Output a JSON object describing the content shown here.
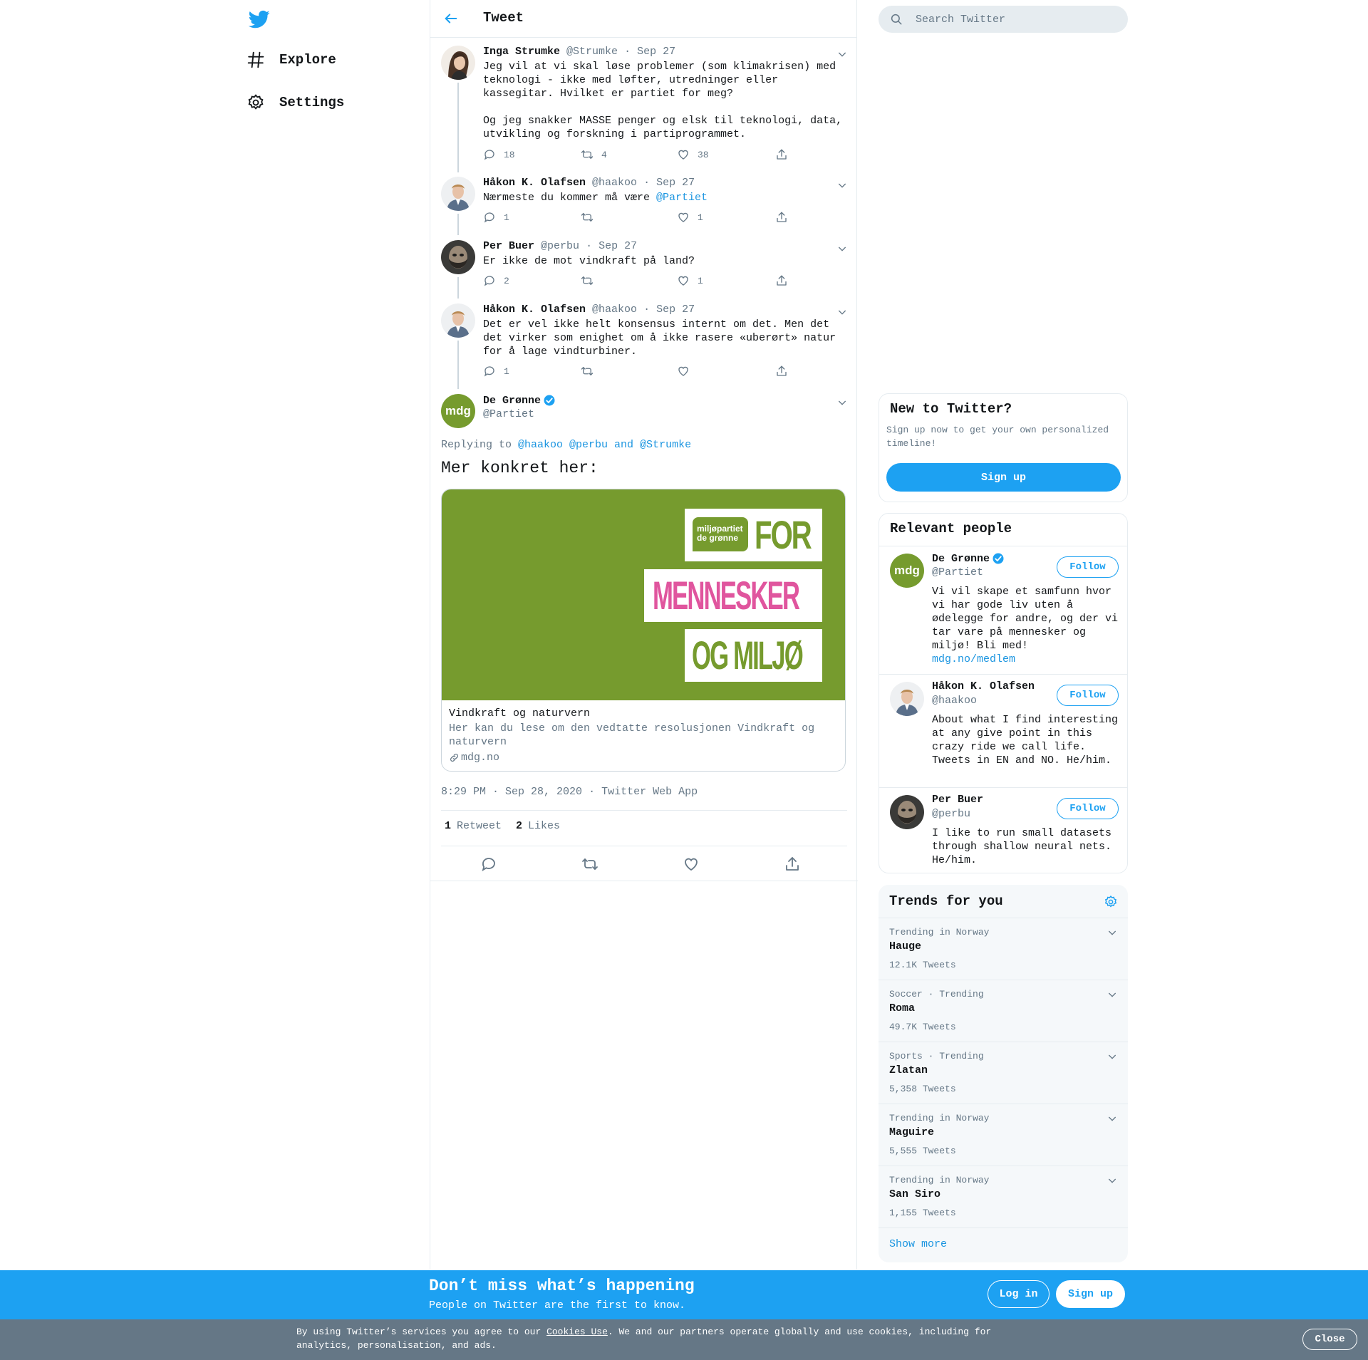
{
  "nav": {
    "items": [
      {
        "label": "Explore",
        "icon": "hashtag-icon"
      },
      {
        "label": "Settings",
        "icon": "gear-icon"
      }
    ]
  },
  "header": {
    "title": "Tweet"
  },
  "thread": [
    {
      "name": "Inga Strumke",
      "handle": "@Strumke",
      "date": "Sep 27",
      "text": "Jeg vil at vi skal løse problemer (som klimakrisen) med\nteknologi - ikke med løfter, utredninger eller\nkassegitar. Hvilket er partiet for meg?\n\nOg jeg snakker MASSE penger og elsk til teknologi, data,\nutvikling og forskning i partiprogrammet.",
      "replies": "18",
      "retweets": "4",
      "likes": "38"
    },
    {
      "name": "Håkon K. Olafsen",
      "handle": "@haakoo",
      "date": "Sep 27",
      "text": "Nærmeste du kommer må være ",
      "mention": "@Partiet",
      "replies": "1",
      "retweets": "",
      "likes": "1"
    },
    {
      "name": "Per Buer",
      "handle": "@perbu",
      "date": "Sep 27",
      "text": "Er ikke de mot vindkraft på land?",
      "replies": "2",
      "retweets": "",
      "likes": "1"
    },
    {
      "name": "Håkon K. Olafsen",
      "handle": "@haakoo",
      "date": "Sep 27",
      "text": "Det er vel ikke helt konsensus internt om det. Men det\ndet virker som enighet om å ikke rasere «uberørt» natur\nfor å lage vindturbiner.",
      "replies": "1",
      "retweets": "",
      "likes": ""
    }
  ],
  "focus": {
    "name": "De Grønne",
    "handle": "@Partiet",
    "avatar_text": "mdg",
    "replying_label": "Replying to ",
    "replying_to": "@haakoo @perbu and @Strumke",
    "text": "Mer konkret her:",
    "card": {
      "image_logo_line1": "miljøpartiet",
      "image_logo_line2": "de grønne",
      "image_word1": "FOR",
      "image_word2": "MENNESKER",
      "image_word3": "OG MILJØ",
      "title": "Vindkraft og naturvern",
      "description": "Her kan du lese om den vedtatte resolusjonen Vindkraft og naturvern",
      "domain": "mdg.no"
    },
    "time": "8:29 PM · Sep 28, 2020",
    "source": "Twitter Web App",
    "retweet_count": "1",
    "retweet_label": "Retweet",
    "like_count": "2",
    "like_label": "Likes"
  },
  "sidebar": {
    "search_placeholder": "Search Twitter",
    "new_to_twitter": {
      "title": "New to Twitter?",
      "text": "Sign up now to get your own personalized timeline!",
      "button": "Sign up"
    },
    "relevant": {
      "title": "Relevant people",
      "follow_label": "Follow",
      "people": [
        {
          "name": "De Grønne",
          "handle": "@Partiet",
          "bio": "Vi vil skape et samfunn hvor vi har gode liv uten å ødelegge for andre, og der vi tar vare på mennesker og miljø! Bli med!",
          "link": "mdg.no/medlem"
        },
        {
          "name": "Håkon K. Olafsen",
          "handle": "@haakoo",
          "bio": "About what I find interesting at any give point in this crazy ride we call life. Tweets in EN and NO. He/him."
        },
        {
          "name": "Per Buer",
          "handle": "@perbu",
          "bio": "I like to run small datasets through shallow neural nets. He/him."
        }
      ]
    },
    "trends": {
      "title": "Trends for you",
      "items": [
        {
          "context": "Trending in Norway",
          "name": "Hauge",
          "count": "12.1K Tweets"
        },
        {
          "context": "Soccer · Trending",
          "name": "Roma",
          "count": "49.7K Tweets"
        },
        {
          "context": "Sports · Trending",
          "name": "Zlatan",
          "count": "5,358 Tweets"
        },
        {
          "context": "Trending in Norway",
          "name": "Maguire",
          "count": "5,555 Tweets"
        },
        {
          "context": "Trending in Norway",
          "name": "San Siro",
          "count": "1,155 Tweets"
        }
      ],
      "show_more": "Show more"
    }
  },
  "banner": {
    "title": "Don’t miss what’s happening",
    "subtitle": "People on Twitter are the first to know.",
    "login": "Log in",
    "signup": "Sign up"
  },
  "cookie": {
    "prefix": "By using Twitter’s services you agree to our ",
    "link": "Cookies Use",
    "suffix": ". We and our partners operate globally and use cookies, including for analytics, personalisation, and ads.",
    "close": "Close"
  },
  "colors": {
    "accent": "#1da1f2",
    "link": "#1b95e0",
    "mdg_green": "#769b2e",
    "mdg_pink": "#e0559e",
    "muted": "#657786"
  }
}
